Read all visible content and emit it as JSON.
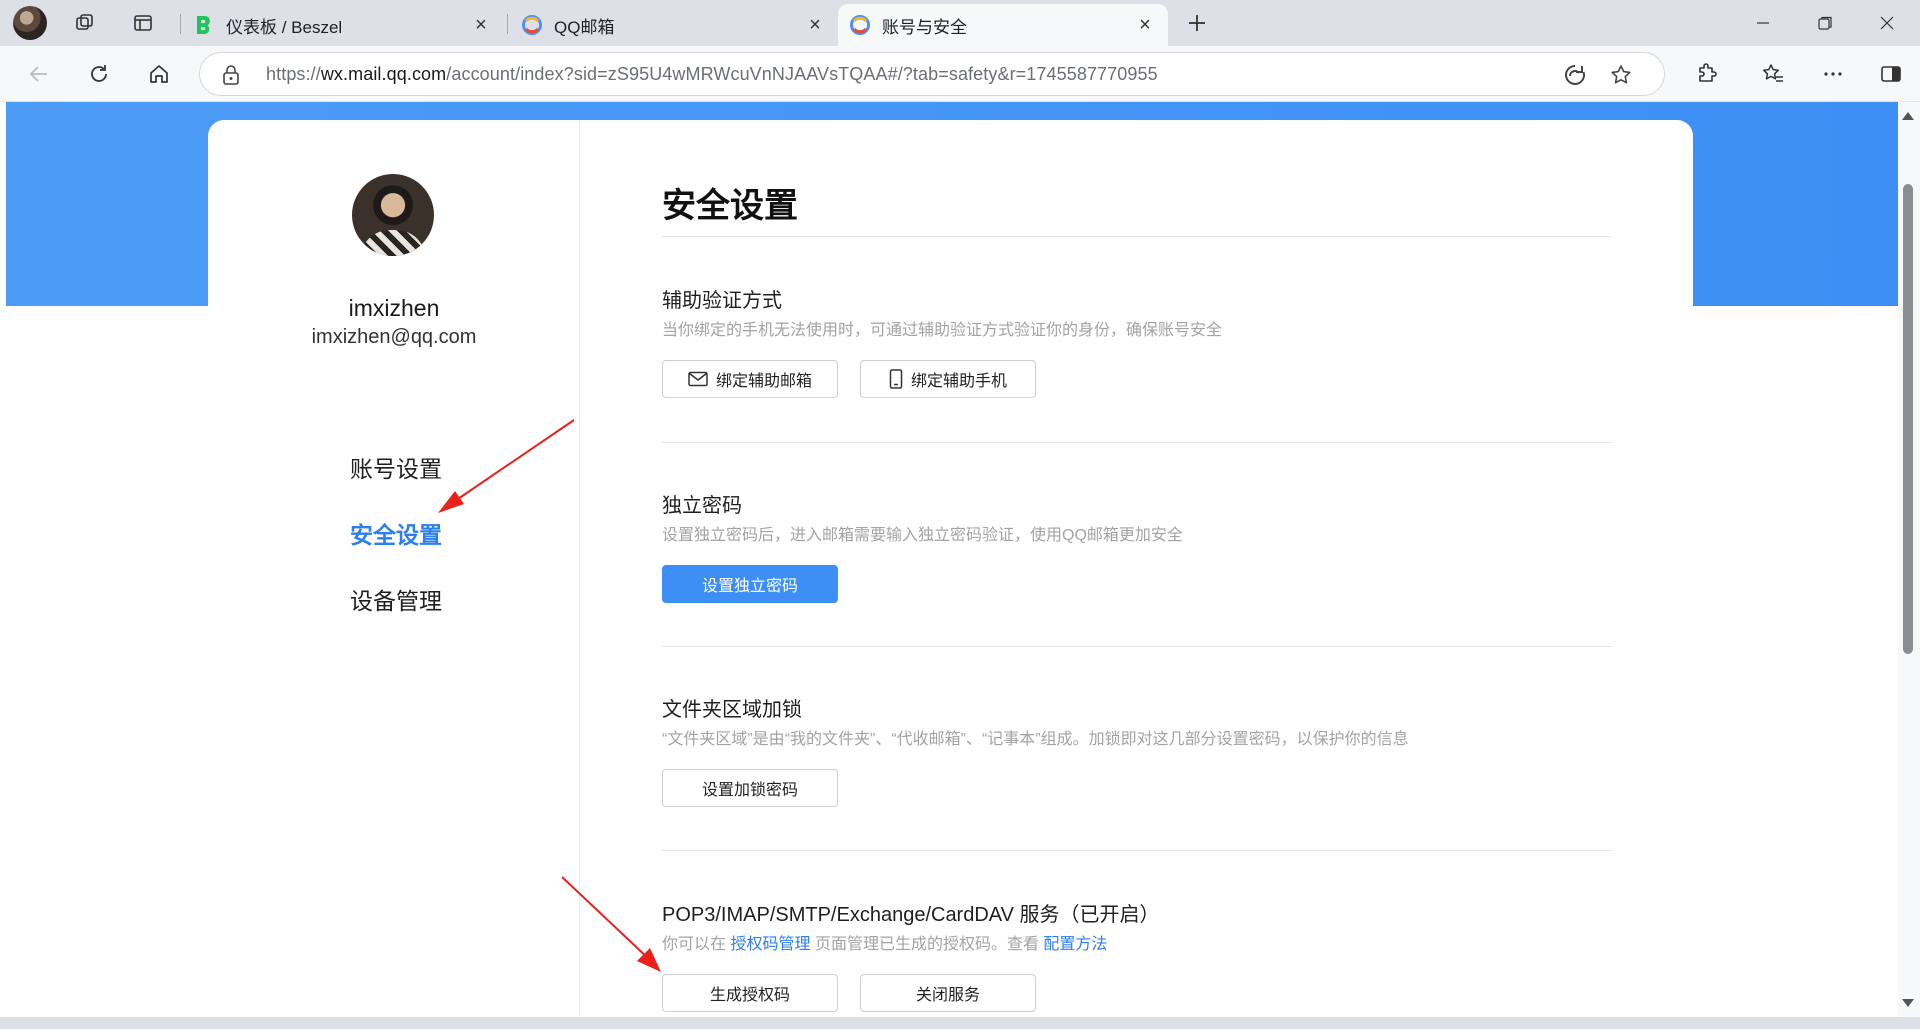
{
  "browser": {
    "tabs": [
      {
        "title": "仪表板 / Beszel",
        "favicon": "beszel-icon",
        "active": false
      },
      {
        "title": "QQ邮箱",
        "favicon": "qqmail-icon",
        "active": false
      },
      {
        "title": "账号与安全",
        "favicon": "qqmail-icon",
        "active": true
      }
    ],
    "address": {
      "scheme": "https://",
      "host": "wx.mail.qq.com",
      "path": "/account/index?sid=zS95U4wMRWcuVnNJAAVsTQAA#/?tab=safety&r=1745587770955"
    }
  },
  "sidebar": {
    "username": "imxizhen",
    "email": "imxizhen@qq.com",
    "nav": [
      {
        "label": "账号设置",
        "active": false
      },
      {
        "label": "安全设置",
        "active": true
      },
      {
        "label": "设备管理",
        "active": false
      }
    ]
  },
  "main": {
    "title": "安全设置",
    "sections": [
      {
        "title": "辅助验证方式",
        "desc": "当你绑定的手机无法使用时，可通过辅助验证方式验证你的身份，确保账号安全",
        "buttons": [
          {
            "label": "绑定辅助邮箱",
            "icon": "mail-icon"
          },
          {
            "label": "绑定辅助手机",
            "icon": "phone-icon"
          }
        ]
      },
      {
        "title": "独立密码",
        "desc": "设置独立密码后，进入邮箱需要输入独立密码验证，使用QQ邮箱更加安全",
        "buttons": [
          {
            "label": "设置独立密码",
            "primary": true
          }
        ]
      },
      {
        "title": "文件夹区域加锁",
        "desc": "“文件夹区域”是由“我的文件夹”、“代收邮箱”、“记事本”组成。加锁即对这几部分设置密码，以保护你的信息",
        "buttons": [
          {
            "label": "设置加锁密码"
          }
        ]
      },
      {
        "title": "POP3/IMAP/SMTP/Exchange/CardDAV 服务（已开启）",
        "desc_prefix": "你可以在",
        "desc_link1": "授权码管理",
        "desc_middle": "页面管理已生成的授权码。查看",
        "desc_link2": "配置方法",
        "buttons": [
          {
            "label": "生成授权码"
          },
          {
            "label": "关闭服务"
          }
        ]
      }
    ]
  },
  "colors": {
    "accent": "#3d8ff5",
    "link": "#2d7ff0",
    "annotation": "#e8211b"
  }
}
